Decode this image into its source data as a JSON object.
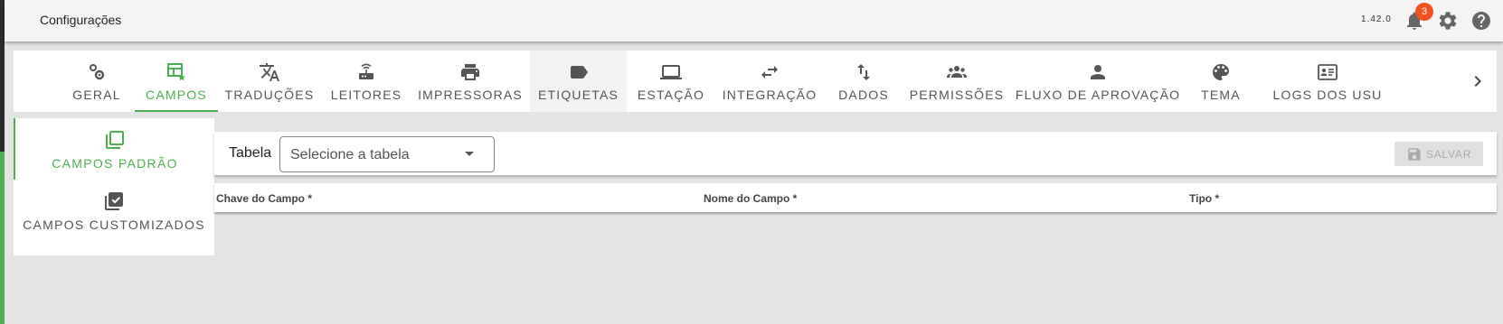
{
  "header": {
    "title": "Configurações",
    "version": "1.42.0",
    "notification_count": "3",
    "icons": [
      "bell-icon",
      "gear-icon",
      "help-icon"
    ]
  },
  "tabs": [
    {
      "label": "GERAL",
      "icon": "gears-icon",
      "active": false
    },
    {
      "label": "CAMPOS",
      "icon": "table-edit-icon",
      "active": true
    },
    {
      "label": "TRADUÇÕES",
      "icon": "translate-icon",
      "active": false
    },
    {
      "label": "LEITORES",
      "icon": "router-icon",
      "active": false
    },
    {
      "label": "IMPRESSORAS",
      "icon": "printer-icon",
      "active": false
    },
    {
      "label": "ETIQUETAS",
      "icon": "label-icon",
      "active": false
    },
    {
      "label": "ESTAÇÃO",
      "icon": "laptop-icon",
      "active": false
    },
    {
      "label": "INTEGRAÇÃO",
      "icon": "swap-horiz-icon",
      "active": false
    },
    {
      "label": "DADOS",
      "icon": "import-export-icon",
      "active": false
    },
    {
      "label": "PERMISSÕES",
      "icon": "people-icon",
      "active": false
    },
    {
      "label": "FLUXO DE APROVAÇÃO",
      "icon": "person-icon",
      "active": false
    },
    {
      "label": "TEMA",
      "icon": "palette-icon",
      "active": false
    },
    {
      "label": "LOGS DOS USU",
      "icon": "id-card-icon",
      "active": false
    }
  ],
  "side": {
    "items": [
      {
        "label": "CAMPOS PADRÃO",
        "icon": "library-icon",
        "active": true
      },
      {
        "label": "CAMPOS CUSTOMIZADOS",
        "icon": "library-check-icon",
        "active": false
      }
    ]
  },
  "toolbar": {
    "table_label": "Tabela",
    "select_placeholder": "Selecione a tabela",
    "save_label": "SALVAR"
  },
  "table": {
    "columns": [
      "Chave do Campo *",
      "Nome do Campo *",
      "Tipo *"
    ]
  },
  "colors": {
    "accent": "#4caf50",
    "badge": "#f4511e",
    "text": "#555555"
  }
}
